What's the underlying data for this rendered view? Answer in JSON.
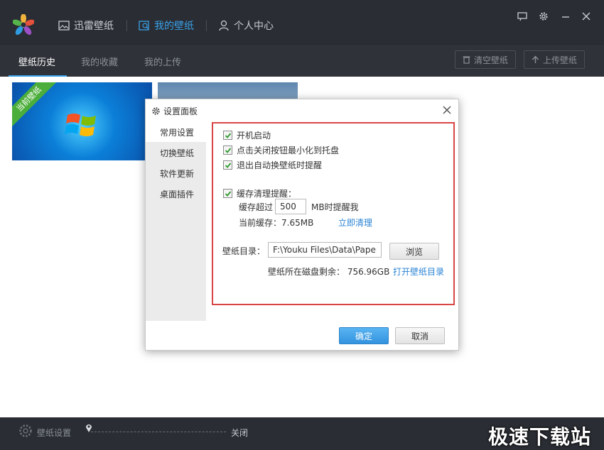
{
  "topbar": {
    "nav": [
      {
        "label": "迅雷壁纸",
        "icon": "image-icon"
      },
      {
        "label": "我的壁纸",
        "icon": "my-wallpaper-icon",
        "active": true
      },
      {
        "label": "个人中心",
        "icon": "user-icon"
      }
    ],
    "window_controls": [
      "feedback-icon",
      "gear-icon",
      "minimize-icon",
      "close-icon"
    ],
    "accent_color": "#3aa0e8"
  },
  "subbar": {
    "tabs": [
      {
        "label": "壁纸历史",
        "active": true
      },
      {
        "label": "我的收藏"
      },
      {
        "label": "我的上传"
      }
    ],
    "clear_button": "清空壁纸",
    "upload_button": "上传壁纸"
  },
  "thumbnails": {
    "current_badge": "当前壁纸"
  },
  "dialog": {
    "title": "设置面板",
    "menu": [
      {
        "label": "常用设置",
        "active": true
      },
      {
        "label": "切换壁纸"
      },
      {
        "label": "软件更新"
      },
      {
        "label": "桌面插件"
      }
    ],
    "options": {
      "startup": "开机启动",
      "minimize_to_tray": "点击关闭按钮最小化到托盘",
      "exit_remind": "退出自动换壁纸时提醒",
      "cache_remind": "缓存清理提醒："
    },
    "cache": {
      "exceed_label": "缓存超过",
      "exceed_value": "500",
      "exceed_suffix": "MB时提醒我",
      "current": "当前缓存：7.65MB",
      "clear_now": "立即清理"
    },
    "directory": {
      "label": "壁纸目录：",
      "path": "F:\\Youku Files\\Data\\Paper",
      "browse": "浏览",
      "free_space": "壁纸所在磁盘剩余： 756.96GB",
      "open_dir": "打开壁纸目录"
    },
    "ok": "确定",
    "cancel": "取消",
    "highlight_color": "#d94545"
  },
  "bottombar": {
    "settings_label": "壁纸设置",
    "slider_state": "关闭",
    "watermark": "极速下载站"
  }
}
